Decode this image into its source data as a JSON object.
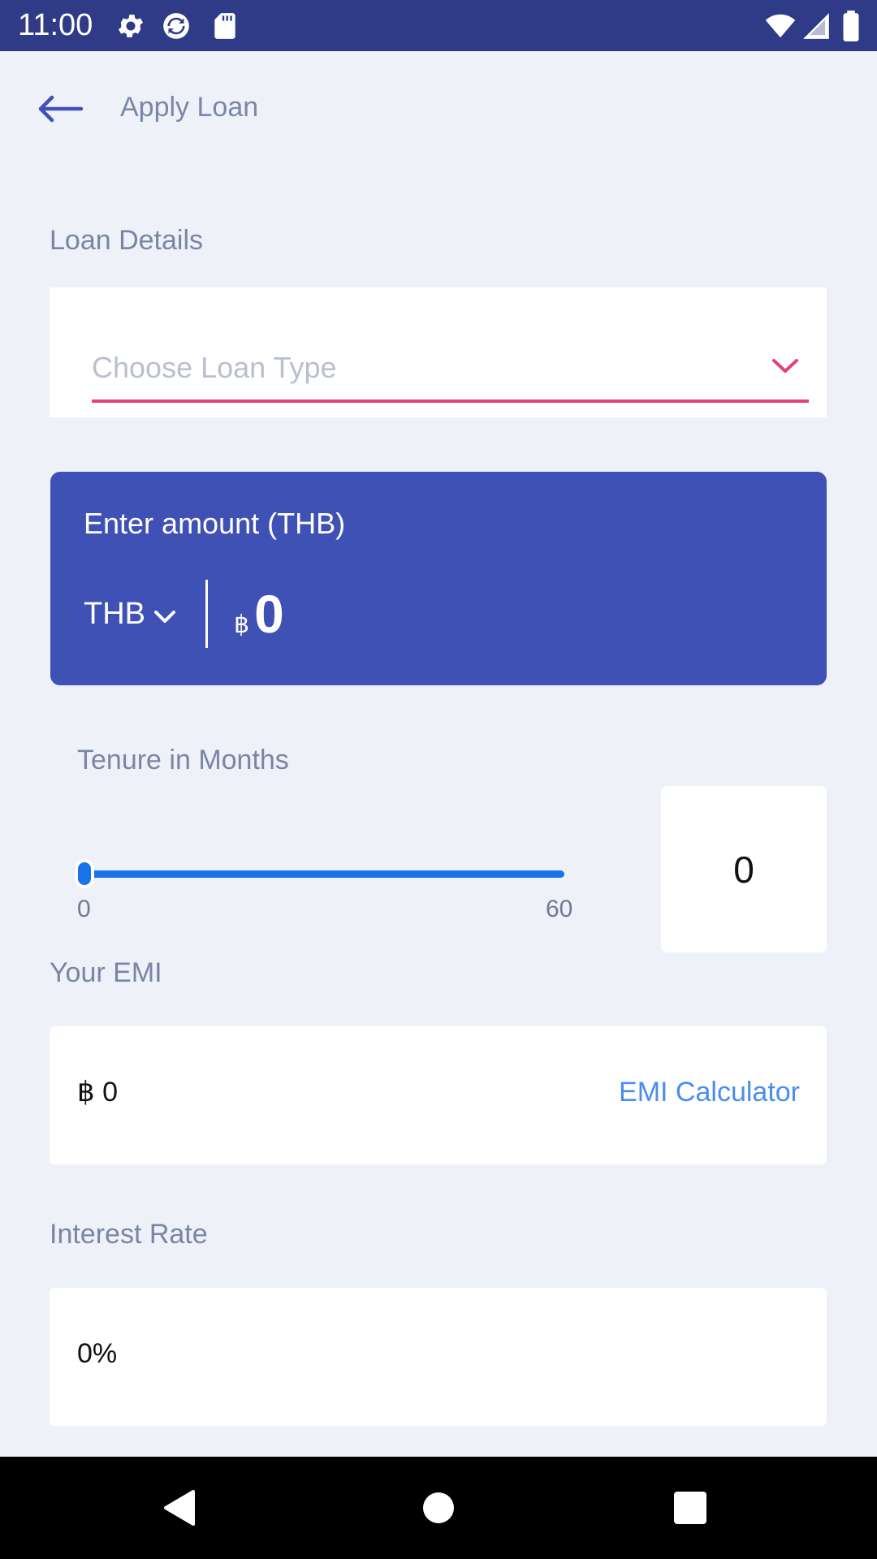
{
  "status_bar": {
    "time": "11:00",
    "icons": [
      "gear-icon",
      "sync-icon",
      "sd-card-icon",
      "wifi-icon",
      "signal-icon",
      "battery-icon"
    ]
  },
  "header": {
    "back_icon": "arrow-left-icon",
    "title": "Apply Loan"
  },
  "loan_details": {
    "label": "Loan Details",
    "select_placeholder": "Choose Loan Type",
    "chevron_icon": "chevron-down-icon"
  },
  "amount": {
    "label": "Enter amount (THB)",
    "currency": "THB",
    "symbol": "฿",
    "value": "0"
  },
  "tenure": {
    "label": "Tenure in Months",
    "slider_min": "0",
    "slider_max": "60",
    "value": "0"
  },
  "emi": {
    "label": "Your EMI",
    "value": "฿ 0",
    "link": "EMI Calculator"
  },
  "interest": {
    "label": "Interest Rate",
    "value": "0%"
  },
  "colors": {
    "status_bar": "#2f3b87",
    "background": "#eef1f8",
    "primary": "#3f51b5",
    "accent": "#e8407a",
    "slider": "#1a73e8",
    "link": "#4a8cf0"
  },
  "nav_bar": {
    "icons": [
      "back-triangle-icon",
      "home-circle-icon",
      "recents-square-icon"
    ]
  }
}
